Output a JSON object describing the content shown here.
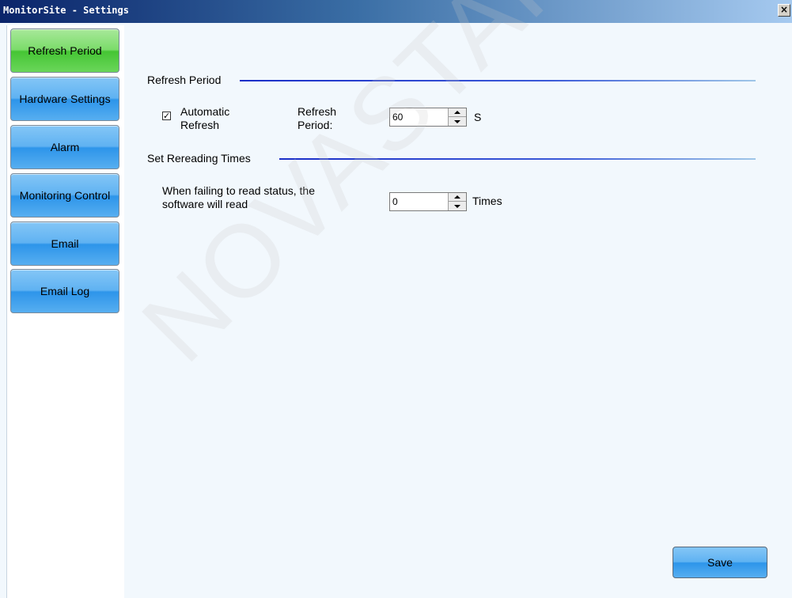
{
  "window": {
    "title": "MonitorSite - Settings",
    "close_glyph": "×"
  },
  "sidebar": {
    "items": [
      {
        "label": "Refresh Period",
        "active": true
      },
      {
        "label": "Hardware Settings",
        "active": false
      },
      {
        "label": "Alarm",
        "active": false
      },
      {
        "label": "Monitoring Control",
        "active": false
      },
      {
        "label": "Email",
        "active": false
      },
      {
        "label": "Email Log",
        "active": false
      }
    ]
  },
  "refresh_section": {
    "title": "Refresh Period",
    "auto_refresh_label": "Automatic Refresh",
    "auto_refresh_checked": true,
    "period_label": "Refresh Period:",
    "period_value": "60",
    "period_unit": "S"
  },
  "reread_section": {
    "title": "Set Rereading Times",
    "desc_label": "When failing to read status, the software will read",
    "times_value": "0",
    "times_unit": "Times"
  },
  "actions": {
    "save_label": "Save"
  },
  "watermark": "NOVASTAR TECH CO., LTD",
  "colors": {
    "active_nav": "#6ad65a",
    "nav": "#3d9ff0",
    "rule": "#1a2ec8"
  }
}
